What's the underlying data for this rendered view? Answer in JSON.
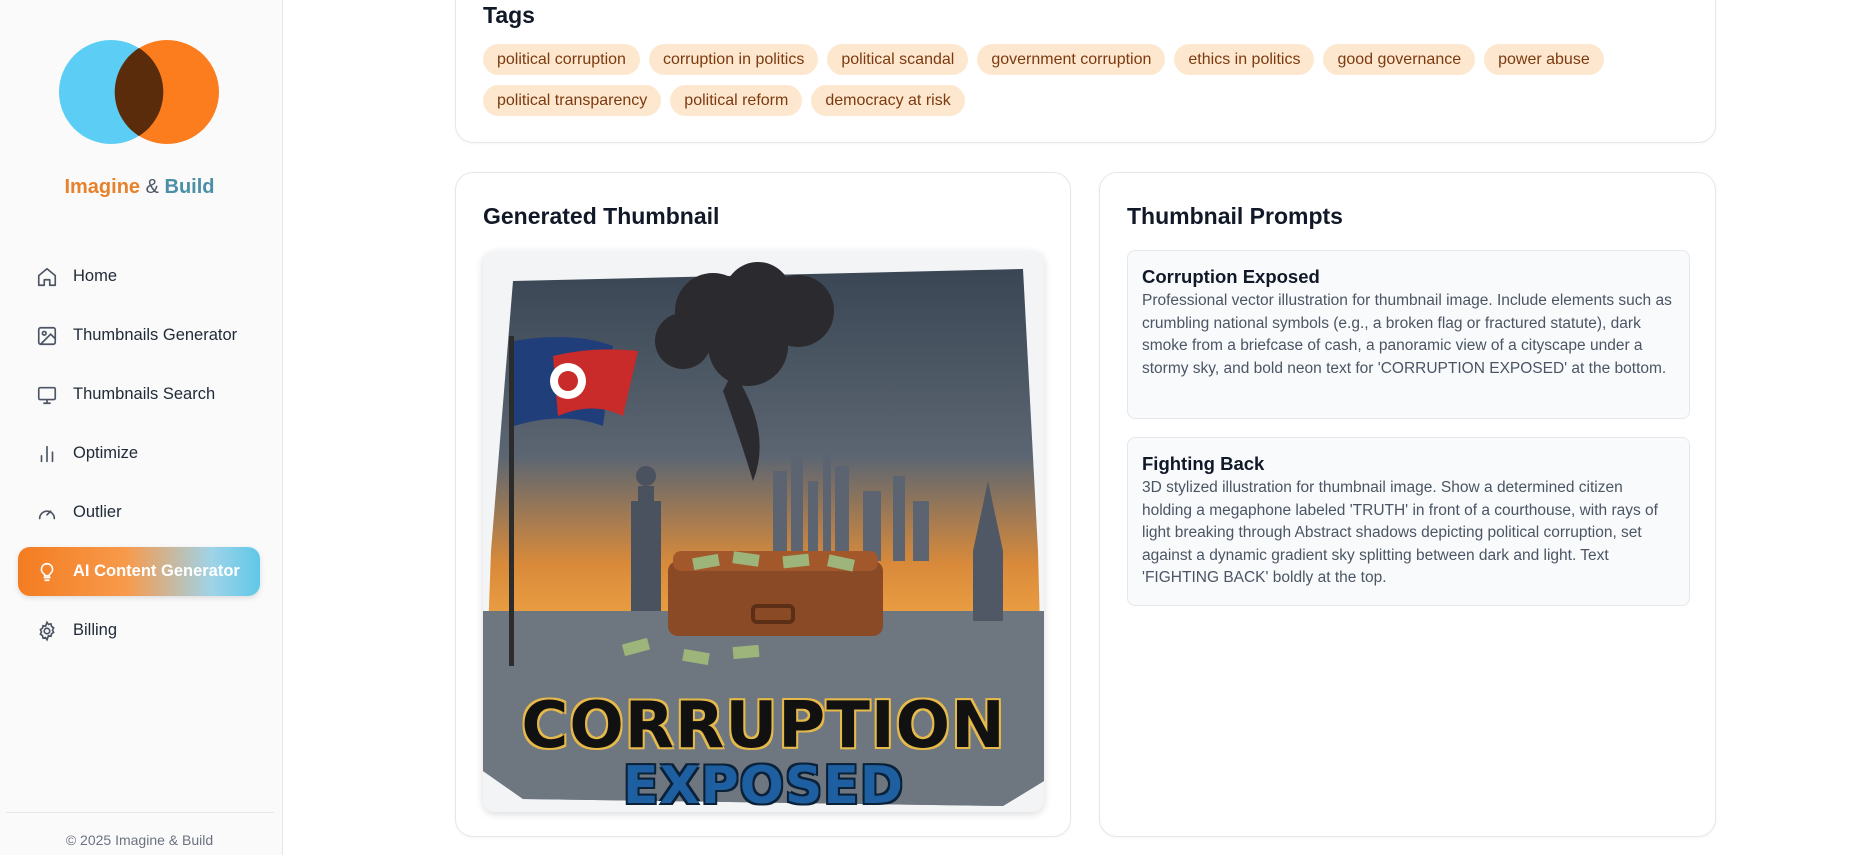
{
  "brand": {
    "part1": "Imagine",
    "sep": "&",
    "part2": "Build"
  },
  "nav": {
    "items": [
      {
        "label": "Home",
        "icon": "home-icon"
      },
      {
        "label": "Thumbnails Generator",
        "icon": "image-icon"
      },
      {
        "label": "Thumbnails Search",
        "icon": "monitor-icon"
      },
      {
        "label": "Optimize",
        "icon": "bar-chart-icon"
      },
      {
        "label": "Outlier",
        "icon": "gauge-icon"
      },
      {
        "label": "AI Content Generator",
        "icon": "lightbulb-icon",
        "active": true
      },
      {
        "label": "Billing",
        "icon": "gear-icon"
      }
    ]
  },
  "footer": {
    "copyright": "© 2025 Imagine & Build"
  },
  "tags": {
    "title": "Tags",
    "items": [
      "political corruption",
      "corruption in politics",
      "political scandal",
      "government corruption",
      "ethics in politics",
      "good governance",
      "power abuse",
      "political transparency",
      "political reform",
      "democracy at risk"
    ]
  },
  "thumbnail": {
    "title": "Generated Thumbnail",
    "image_text_line1": "CORRUPTION",
    "image_text_line2": "EXPOSED"
  },
  "prompts": {
    "title": "Thumbnail Prompts",
    "items": [
      {
        "title": "Corruption Exposed",
        "text": "Professional vector illustration for thumbnail image. Include elements such as crumbling national symbols (e.g., a broken flag or fractured statute), dark smoke from a briefcase of cash, a panoramic view of a cityscape under a stormy sky, and bold neon text for 'CORRUPTION EXPOSED' at the bottom."
      },
      {
        "title": "Fighting Back",
        "text": "3D stylized illustration for thumbnail image. Show a determined citizen holding a megaphone labeled 'TRUTH' in front of a courthouse, with rays of light breaking through Abstract shadows depicting political corruption, set against a dynamic gradient sky splitting between dark and light. Text 'FIGHTING BACK' boldly at the top."
      }
    ]
  },
  "colors": {
    "accent_orange": "#f47c20",
    "accent_blue": "#5fc8e8",
    "tag_bg": "#fde8cf",
    "tag_text": "#7c3a10"
  }
}
